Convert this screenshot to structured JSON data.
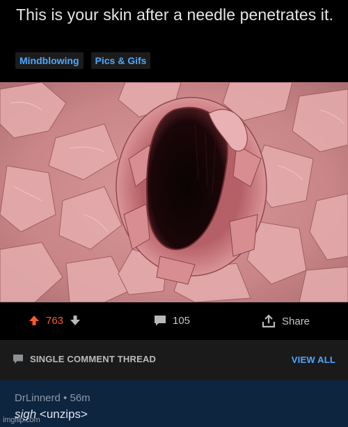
{
  "post": {
    "title": "This is your skin after a needle penetrates it.",
    "flairs": [
      "Mindblowing",
      "Pics & Gifs"
    ]
  },
  "actions": {
    "upvote_count": "763",
    "comment_count": "105",
    "share_label": "Share"
  },
  "thread": {
    "label": "SINGLE COMMENT THREAD",
    "view_all": "VIEW ALL"
  },
  "comment": {
    "author": "DrLinnerd",
    "separator": "•",
    "age": "56m",
    "body_italic": "sigh",
    "body_rest": " <unzips>"
  },
  "watermark": "imgflip.com",
  "colors": {
    "background": "#000000",
    "flair_text": "#4fa8ff",
    "upvote_active": "#ff5a2b",
    "thread_bar": "#1a1a1b",
    "comment_highlight": "#0e2540"
  },
  "icons": {
    "upvote": "arrow-up-icon",
    "downvote": "arrow-down-icon",
    "comments": "speech-bubble-icon",
    "share": "share-icon",
    "thread": "speech-bubble-icon"
  }
}
